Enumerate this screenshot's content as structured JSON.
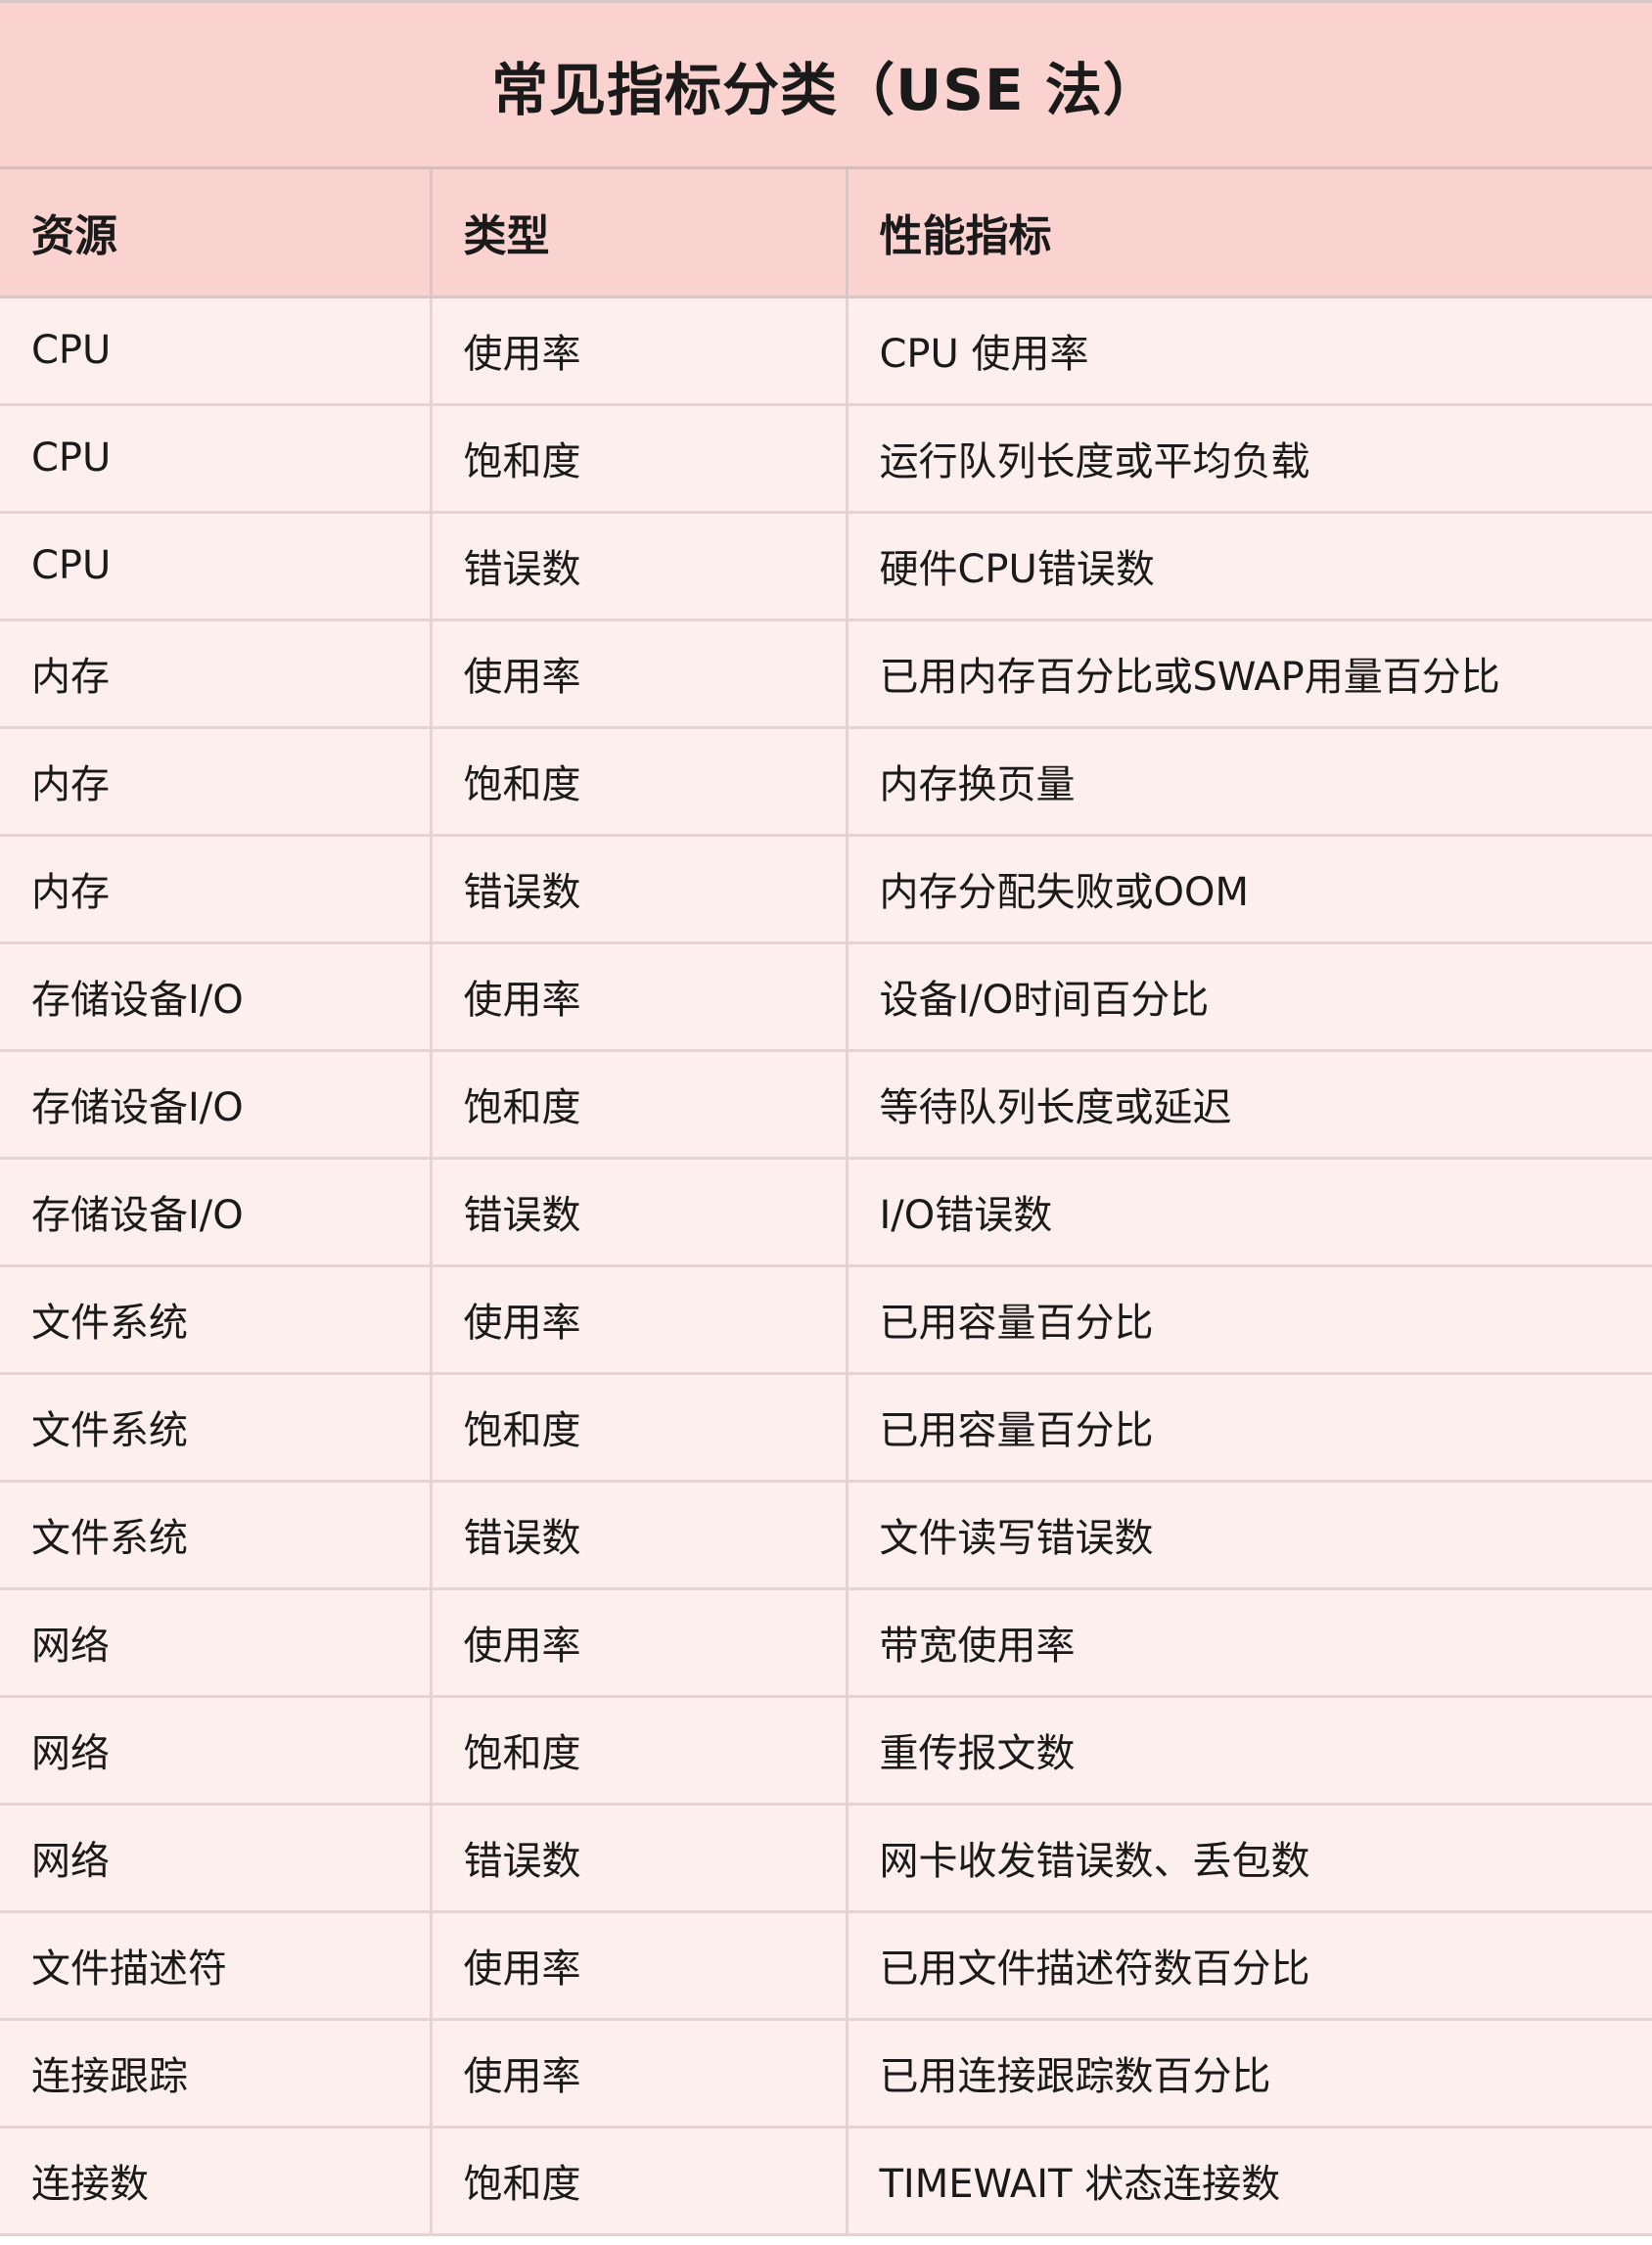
{
  "title": "常见指标分类（USE 法）",
  "columns": [
    "资源",
    "类型",
    "性能指标"
  ],
  "rows": [
    [
      "CPU",
      "使用率",
      "CPU 使用率"
    ],
    [
      "CPU",
      "饱和度",
      "运行队列长度或平均负载"
    ],
    [
      "CPU",
      "错误数",
      "硬件CPU错误数"
    ],
    [
      "内存",
      "使用率",
      "已用内存百分比或SWAP用量百分比"
    ],
    [
      "内存",
      "饱和度",
      "内存换页量"
    ],
    [
      "内存",
      "错误数",
      "内存分配失败或OOM"
    ],
    [
      "存储设备I/O",
      "使用率",
      "设备I/O时间百分比"
    ],
    [
      "存储设备I/O",
      "饱和度",
      "等待队列长度或延迟"
    ],
    [
      "存储设备I/O",
      "错误数",
      "I/O错误数"
    ],
    [
      "文件系统",
      "使用率",
      "已用容量百分比"
    ],
    [
      "文件系统",
      "饱和度",
      "已用容量百分比"
    ],
    [
      "文件系统",
      "错误数",
      "文件读写错误数"
    ],
    [
      "网络",
      "使用率",
      "带宽使用率"
    ],
    [
      "网络",
      "饱和度",
      "重传报文数"
    ],
    [
      "网络",
      "错误数",
      "网卡收发错误数、丢包数"
    ],
    [
      "文件描述符",
      "使用率",
      "已用文件描述符数百分比"
    ],
    [
      "连接跟踪",
      "使用率",
      "已用连接跟踪数百分比"
    ],
    [
      "连接数",
      "饱和度",
      "TIMEWAIT 状态连接数"
    ]
  ],
  "colors": {
    "header_bg": "#fad2cf",
    "row_bg": "#fdefed",
    "border": "#e3d4d2"
  }
}
